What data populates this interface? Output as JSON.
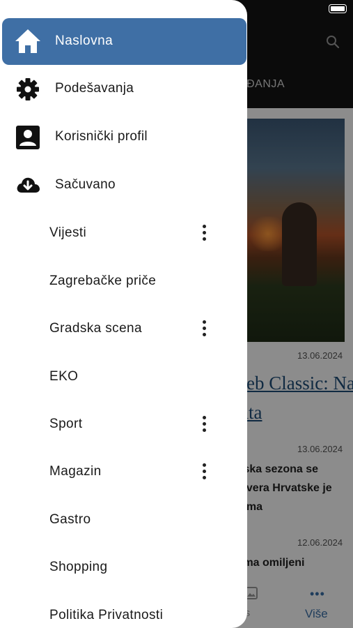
{
  "status_bar": {
    "battery_icon": "battery-icon"
  },
  "background_app": {
    "tab_label": "GAĐANJA",
    "articles": [
      {
        "date": "13.06.2024",
        "headline_lines": [
          "reb Classic: Na",
          "ata"
        ]
      },
      {
        "date": "13.06.2024",
        "text_lines": [
          "lska sezona se",
          "evera Hrvatske je",
          "jima"
        ]
      },
      {
        "date": "12.06.2024",
        "text_lines": [
          "ima omiljeni"
        ]
      }
    ],
    "bottom_nav": {
      "reels_label": "els",
      "more_label": "Više",
      "more_icon": "more-dots-icon"
    }
  },
  "drawer": {
    "main_items": [
      {
        "label": "Naslovna",
        "icon": "home-icon",
        "active": true
      },
      {
        "label": "Podešavanja",
        "icon": "gear-icon"
      },
      {
        "label": "Korisnički profil",
        "icon": "profile-icon"
      },
      {
        "label": "Sačuvano",
        "icon": "cloud-download-icon"
      }
    ],
    "categories": [
      {
        "label": "Vijesti",
        "has_menu": true
      },
      {
        "label": "Zagrebačke priče",
        "has_menu": false
      },
      {
        "label": "Gradska scena",
        "has_menu": true
      },
      {
        "label": "EKO",
        "has_menu": false
      },
      {
        "label": "Sport",
        "has_menu": true
      },
      {
        "label": "Magazin",
        "has_menu": true
      },
      {
        "label": "Gastro",
        "has_menu": false
      },
      {
        "label": "Shopping",
        "has_menu": false
      },
      {
        "label": "Politika Privatnosti",
        "has_menu": false
      }
    ]
  },
  "colors": {
    "accent": "#3f6fa5",
    "header": "#151515",
    "headline": "#1e4d78"
  }
}
